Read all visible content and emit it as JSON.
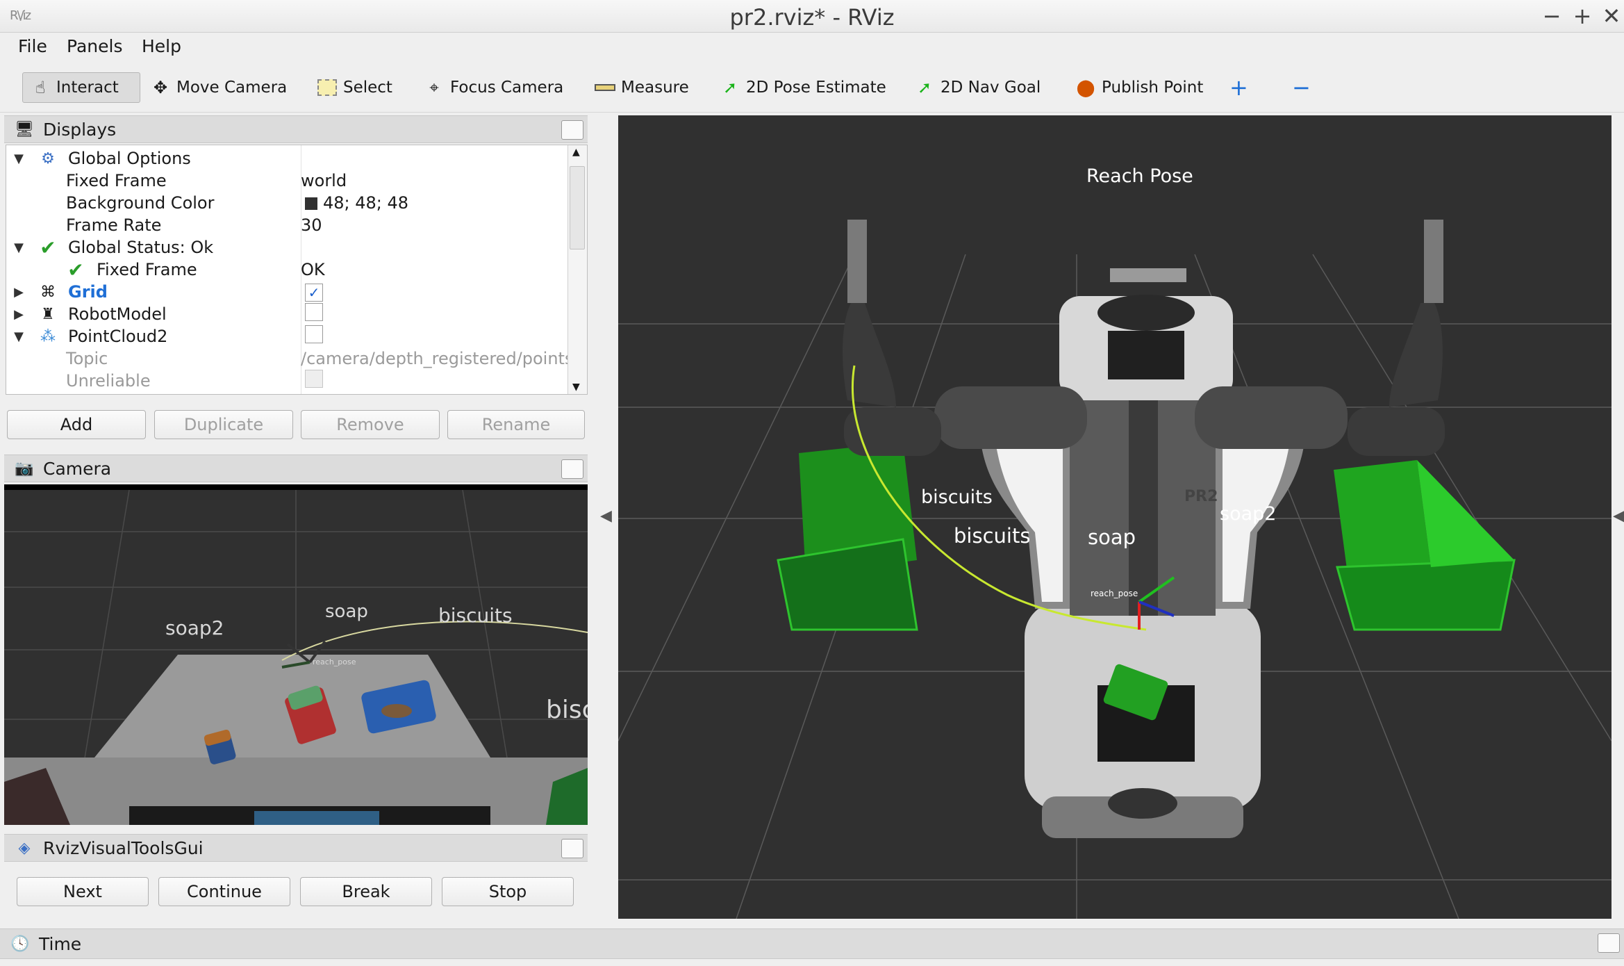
{
  "window": {
    "title": "pr2.rviz* - RViz",
    "minimize": "−",
    "maximize": "+",
    "close": "✕",
    "app_icon": "rviz-icon"
  },
  "menu": [
    {
      "label": "File"
    },
    {
      "label": "Panels"
    },
    {
      "label": "Help"
    }
  ],
  "toolbar": {
    "interact": "Interact",
    "move_camera": "Move Camera",
    "select": "Select",
    "focus_camera": "Focus Camera",
    "measure": "Measure",
    "pose_estimate": "2D Pose Estimate",
    "nav_goal": "2D Nav Goal",
    "publish_point": "Publish Point",
    "add_tool": "+",
    "remove_tool": "−"
  },
  "displays": {
    "title": "Displays",
    "rows": {
      "global_options": "Global Options",
      "fixed_frame": "Fixed Frame",
      "fixed_frame_val": "world",
      "bg_color": "Background Color",
      "bg_color_val": "48; 48; 48",
      "frame_rate": "Frame Rate",
      "frame_rate_val": "30",
      "global_status": "Global Status: Ok",
      "status_fixed_frame": "Fixed Frame",
      "status_fixed_frame_val": "OK",
      "grid": "Grid",
      "robot_model": "RobotModel",
      "pointcloud": "PointCloud2",
      "topic": "Topic",
      "topic_val": "/camera/depth_registered/points",
      "unreliable": "Unreliable"
    },
    "buttons": {
      "add": "Add",
      "duplicate": "Duplicate",
      "remove": "Remove",
      "rename": "Rename"
    }
  },
  "camera": {
    "title": "Camera",
    "labels": {
      "soap2": "soap2",
      "soap": "soap",
      "biscuits": "biscuits",
      "bisc": "bisc",
      "reach": "reach_pose"
    }
  },
  "rviz_visual_tools": {
    "title": "RvizVisualToolsGui",
    "buttons": {
      "next": "Next",
      "continue": "Continue",
      "break": "Break",
      "stop": "Stop"
    }
  },
  "view3d": {
    "reach_pose_title": "Reach  Pose",
    "labels": {
      "biscuits_a": "biscuits",
      "biscuits_b": "biscuits",
      "soap": "soap",
      "soap2": "soap2",
      "reach_pose": "reach_pose",
      "pr2": "PR2"
    }
  },
  "time": {
    "title": "Time"
  },
  "colors": {
    "accent_blue": "#1f6fd6",
    "check_green": "#2a9d2a",
    "bin_green": "#1aa51a",
    "bg": "#303030"
  }
}
